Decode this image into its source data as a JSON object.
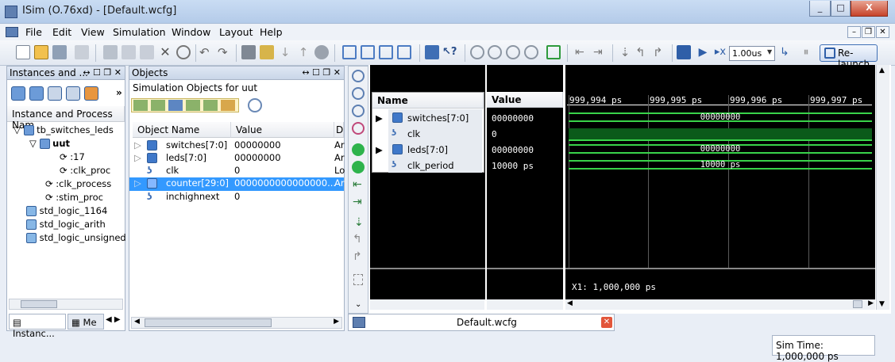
{
  "window": {
    "title": "ISim (O.76xd) - [Default.wcfg]",
    "min": "_",
    "max": "□",
    "close": "X"
  },
  "menu": [
    "File",
    "Edit",
    "View",
    "Simulation",
    "Window",
    "Layout",
    "Help"
  ],
  "toolbar": {
    "zoom": "1.00us",
    "relaunch": "Re-launch"
  },
  "instances_panel": {
    "title": "Instances and ...",
    "column": "Instance and Process Nam",
    "items": [
      "tb_switches_leds",
      "uut",
      ":17",
      ":clk_proc",
      ":clk_process",
      ":stim_proc",
      "std_logic_1164",
      "std_logic_arith",
      "std_logic_unsigned"
    ],
    "tab_instances": "Instanc...",
    "tab_memory": "Me"
  },
  "objects_panel": {
    "title": "Objects",
    "subtitle": "Simulation Objects for uut",
    "col_name": "Object Name",
    "col_value": "Value",
    "col_type": "D",
    "rows": [
      {
        "name": "switches[7:0]",
        "value": "00000000",
        "type": "Ar"
      },
      {
        "name": "leds[7:0]",
        "value": "00000000",
        "type": "Ar"
      },
      {
        "name": "clk",
        "value": "0",
        "type": "Lo"
      },
      {
        "name": "counter[29:0]",
        "value": "0000000000000000...",
        "type": "Ar"
      },
      {
        "name": "inchighnext",
        "value": "0",
        "type": "Lo"
      }
    ]
  },
  "wave": {
    "name_header": "Name",
    "value_header": "Value",
    "signals": [
      {
        "name": "switches[7:0]",
        "value": "00000000"
      },
      {
        "name": "clk",
        "value": "0"
      },
      {
        "name": "leds[7:0]",
        "value": "00000000"
      },
      {
        "name": "clk_period",
        "value": "10000 ps"
      }
    ],
    "time_labels": [
      "999,994 ps",
      "999,995 ps",
      "999,996 ps",
      "999,997 ps"
    ],
    "bus_values": [
      "00000000",
      "00000000",
      "10000 ps"
    ],
    "cursor": "X1: 1,000,000 ps",
    "tab": "Default.wcfg"
  },
  "status": {
    "sim_time": "Sim Time: 1,000,000 ps"
  },
  "colors": {
    "wave_green": "#39d34a",
    "selection": "#3399ff"
  }
}
